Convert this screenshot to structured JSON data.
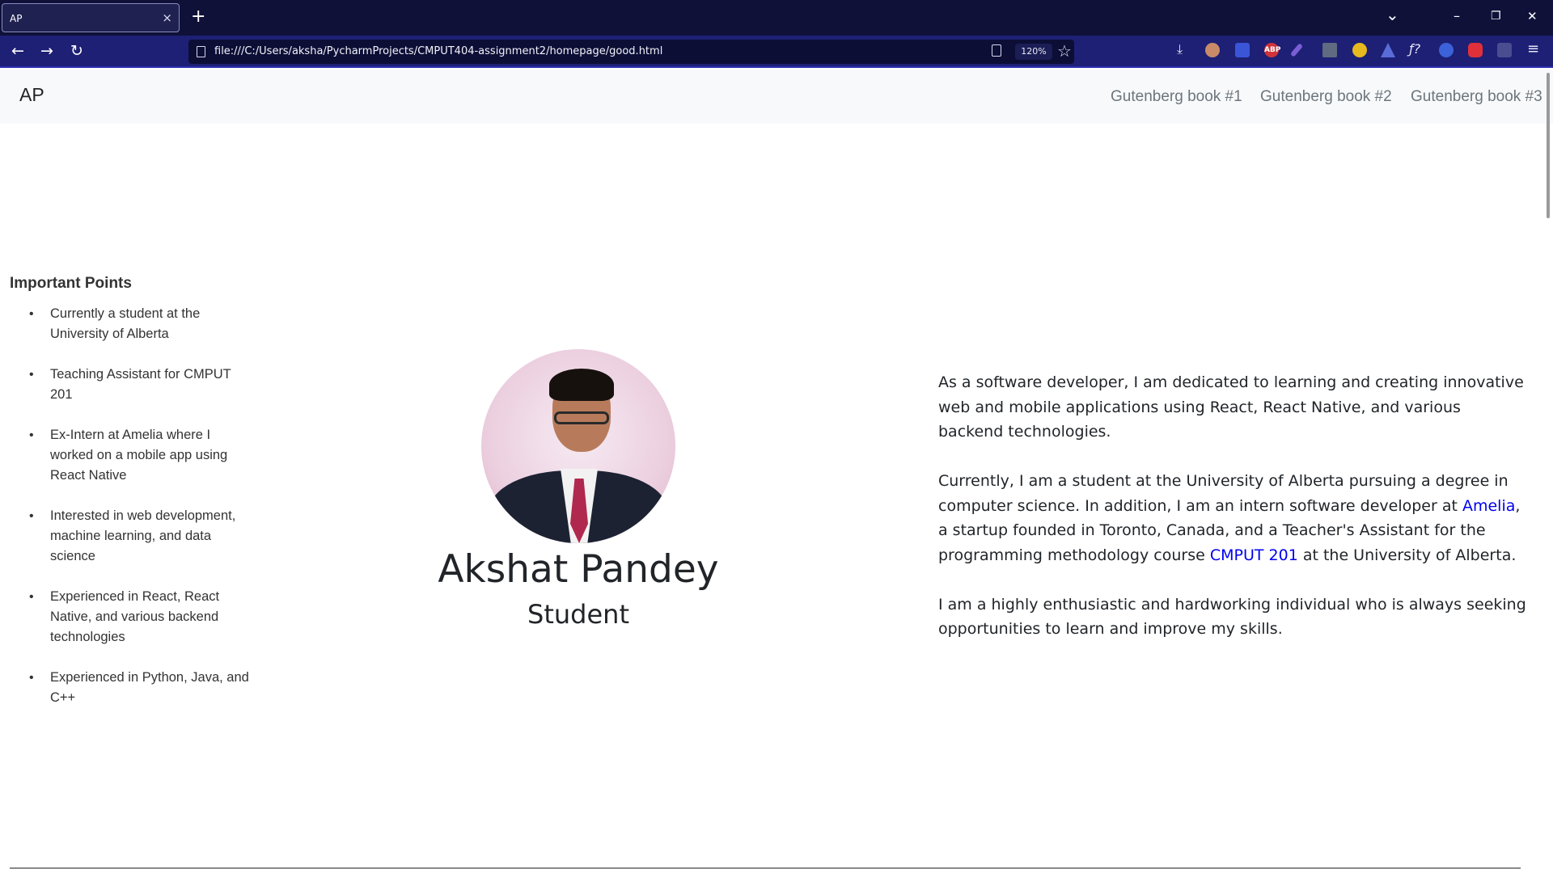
{
  "browser": {
    "tab_title": "AP",
    "tab_close": "×",
    "new_tab": "+",
    "url": "file:///C:/Users/aksha/PycharmProjects/CMPUT404-assignment2/homepage/good.html",
    "zoom": "120%",
    "icons": {
      "back": "←",
      "forward": "→",
      "reload": "↻",
      "star": "☆",
      "tab_list": "⌄",
      "minimize": "–",
      "restore": "❐",
      "close": "✕",
      "download": "⤓",
      "adblock": "ABP",
      "menu": "≡"
    }
  },
  "site": {
    "brand": "AP",
    "nav_links": [
      "Gutenberg book #1",
      "Gutenberg book #2",
      "Gutenberg book #3"
    ]
  },
  "points": {
    "heading": "Important Points",
    "items": [
      "Currently a student at the University of Alberta",
      "Teaching Assistant for CMPUT 201",
      "Ex-Intern at Amelia where I worked on a mobile app using React Native",
      "Interested in web development, machine learning, and data science",
      "Experienced in React, React Native, and various backend technologies",
      "Experienced in Python, Java, and C++"
    ]
  },
  "profile": {
    "name": "Akshat Pandey",
    "role": "Student"
  },
  "bio": {
    "p1": "As a software developer, I am dedicated to learning and creating innovative web and mobile applications using React, React Native, and various backend technologies.",
    "p2_a": "Currently, I am a student at the University of Alberta pursuing a degree in computer science. In addition, I am an intern software developer at ",
    "p2_link1": "Amelia",
    "p2_b": ", a startup founded in Toronto, Canada, and a Teacher's Assistant for the programming methodology course ",
    "p2_link2": "CMPUT 201",
    "p2_c": " at the University of Alberta.",
    "p3": "I am a highly enthusiastic and hardworking individual who is always seeking opportunities to learn and improve my skills."
  },
  "colors": {
    "tabbar": "#0f1139",
    "navbar": "#1d2074",
    "site_nav_bg": "#f8f9fa",
    "link": "#0000ee"
  }
}
